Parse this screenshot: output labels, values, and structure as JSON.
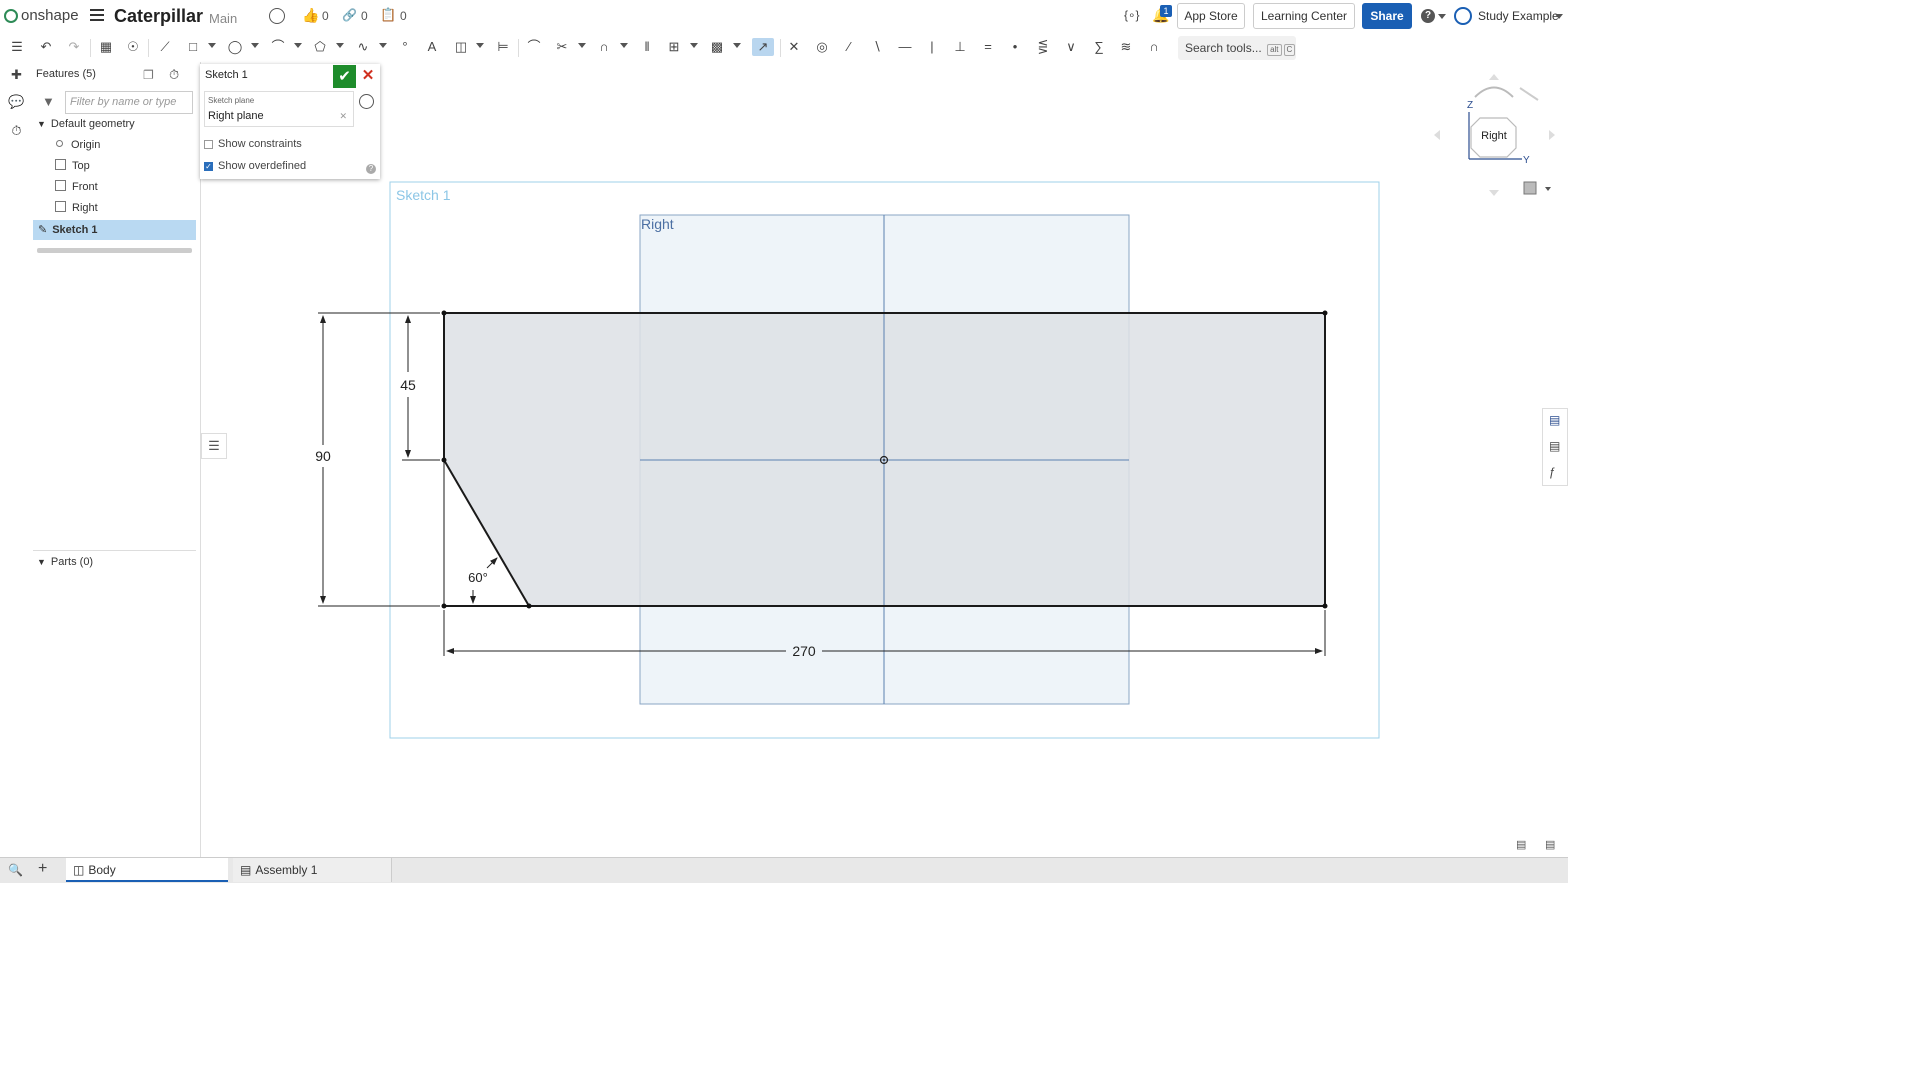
{
  "app": {
    "logo_text": "onshape",
    "doc_title": "Caterpillar",
    "branch": "Main"
  },
  "topbar": {
    "likes": "0",
    "links": "0",
    "copies": "0",
    "notif_count": "1",
    "app_store": "App Store",
    "learning_center": "Learning Center",
    "share": "Share",
    "user": "Study Example"
  },
  "toolbar": {
    "search_label": "Search tools...",
    "search_kbd_alt": "alt",
    "search_kbd_key": "C"
  },
  "features": {
    "header": "Features (5)",
    "filter_placeholder": "Filter by name or type",
    "default_geometry": "Default geometry",
    "items": [
      "Origin",
      "Top",
      "Front",
      "Right"
    ],
    "selected": "Sketch 1",
    "parts_header": "Parts (0)"
  },
  "sketch_dialog": {
    "title": "Sketch 1",
    "plane_label": "Sketch plane",
    "plane_value": "Right plane",
    "show_constraints": "Show constraints",
    "show_overdefined": "Show overdefined"
  },
  "viewport": {
    "sketch_label": "Sketch 1",
    "plane_label": "Right",
    "dim_45": "45",
    "dim_90": "90",
    "dim_270": "270",
    "dim_angle": "60°",
    "navcube_face": "Right",
    "axis_z": "Z",
    "axis_y": "Y"
  },
  "tabs": {
    "body": "Body",
    "assembly": "Assembly 1"
  }
}
